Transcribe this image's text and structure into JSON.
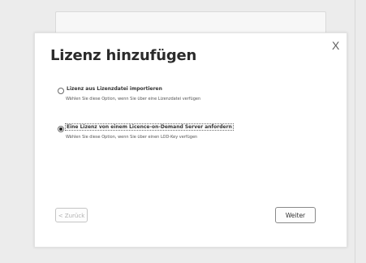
{
  "dialog": {
    "title": "Lizenz hinzufügen",
    "close_label": "X",
    "options": [
      {
        "label": "Lizenz aus Lizenzdatei importieren",
        "description": "Wählen Sie diese Option, wenn Sie über eine Lizenzdatei verfügen",
        "selected": false
      },
      {
        "label": "Eine Lizenz von einem Licence-on-Demand Server anfordern",
        "description": "Wählen Sie diese Option, wenn Sie über einen LOD-Key verfügen",
        "selected": true
      }
    ],
    "back_label": "< Zurück",
    "next_label": "Weiter"
  }
}
